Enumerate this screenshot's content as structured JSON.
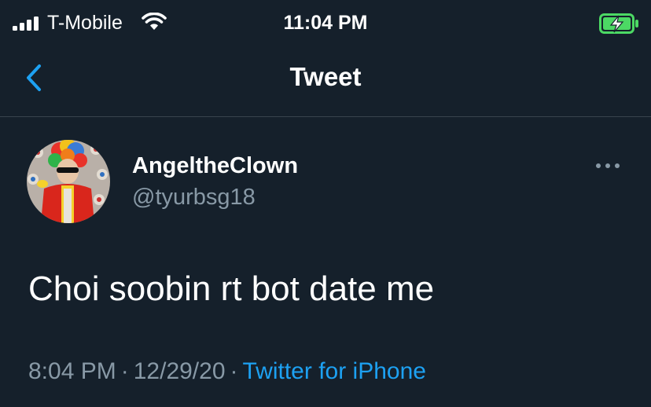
{
  "status_bar": {
    "carrier": "T-Mobile",
    "time": "11:04 PM",
    "signal_icon": "signal-bars-icon",
    "wifi_icon": "wifi-icon",
    "battery_icon": "battery-charging-icon",
    "battery_color": "#4cd964"
  },
  "nav": {
    "back_icon": "chevron-left-icon",
    "title": "Tweet"
  },
  "tweet": {
    "author": {
      "display_name": "AngeltheClown",
      "handle": "@tyurbsg18",
      "avatar_icon": "clown-avatar"
    },
    "more_icon": "more-horizontal-icon",
    "text": "Choi soobin rt bot date me",
    "time": "8:04 PM",
    "separator_1": "·",
    "date": "12/29/20",
    "separator_2": "·",
    "source": "Twitter for iPhone"
  },
  "colors": {
    "background": "#15202b",
    "divider": "#38444d",
    "secondary_text": "#8899a6",
    "accent": "#1da1f2"
  }
}
